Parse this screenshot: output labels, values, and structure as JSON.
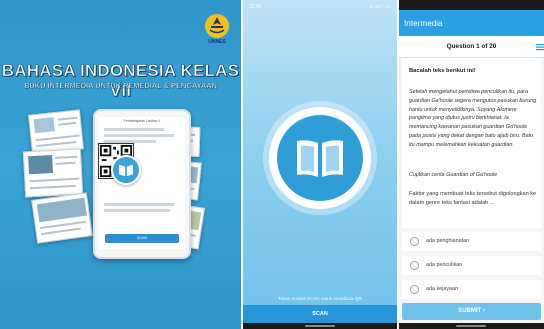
{
  "cover": {
    "title": "BAHASA INDONESIA KELAS VII",
    "subtitle": "BUKU INTERMEDIA UNTUK REMEDIAL & PENGAYAAN",
    "logo_text": "UNNES",
    "tablet_header": "Pembelajaran Latihan 1",
    "tablet_button": "SCAN"
  },
  "scanner": {
    "status_time": "22.61",
    "status_icons": "≡ .ull ≈ ▭",
    "hint": "Tekan tombol SCAN untuk membaca QR",
    "scan_button": "SCAN"
  },
  "quiz": {
    "app_title": "Intermedia",
    "question_number": "Question 1 of 20",
    "instruction": "Bacalah teks berikut ini!",
    "passage": "Setelah mengetahui peristiwa   penculikan itu, para guardian Ga'hoole segera  mengutus pasukan burung hantu untuk menyelidikinya. Soyang Alomere panglima   yang diutus justru berkhianat. Ia memancing kawanan pasukan guardian Ga'hoole pada posisi yang dekat dengan batu ajaib biru. Batu itu   mampu melemahkan kekuatan guardian.",
    "citation": "Cuplikan cerita Guardian of Ga'hoole",
    "question": "Faktor yang membuat teks tersebut digolongkan ke dalam genre teks fantasi adalah ...",
    "options": [
      {
        "label": "ada penghianatan"
      },
      {
        "label": "ada penculikan"
      },
      {
        "label": "ada kejayaan"
      }
    ],
    "submit_label": "SUBMIT  ›"
  },
  "colors": {
    "cover_blue": "#3aa4d6",
    "app_bar_blue": "#29a0e3",
    "submit_blue": "#6fc1ea",
    "scan_button_blue": "#2696d9"
  }
}
